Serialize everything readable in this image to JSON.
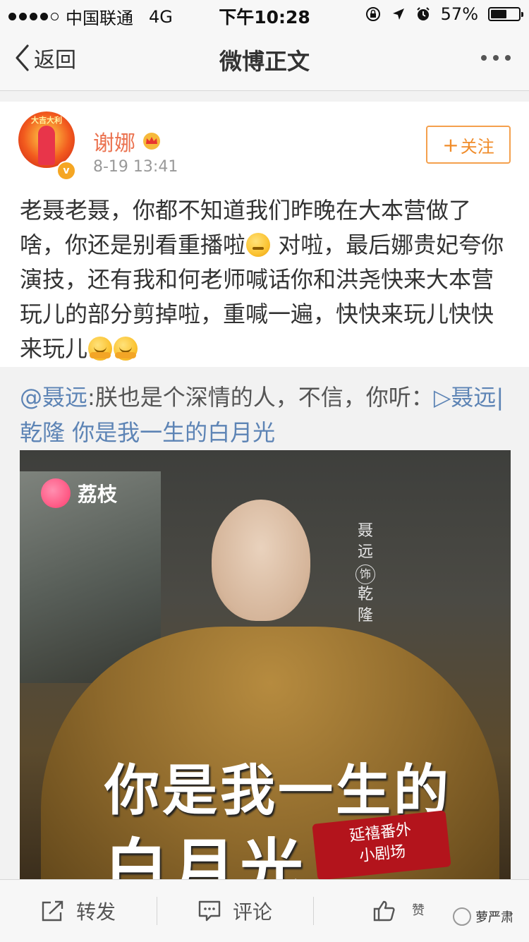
{
  "status_bar": {
    "carrier": "中国联通",
    "network": "4G",
    "time": "下午10:28",
    "battery": "57%",
    "battery_level": 0.57
  },
  "nav": {
    "back_label": "返回",
    "title": "微博正文"
  },
  "post": {
    "username": "谢娜",
    "timestamp": "8-19 13:41",
    "follow_label": "关注",
    "avatar_caption": "大吉大利",
    "text_a": "老聂老聂，你都不知道我们昨晚在大本营做了啥，你还是别看重播啦",
    "text_b": " 对啦，最后娜贵妃夸你演技，还有我和何老师喊话你和洪尧快来大本营玩儿的部分剪掉啦，重喊一遍，快快来玩儿快快来玩儿"
  },
  "repost": {
    "mention": "@聂远",
    "text": ":朕也是个深情的人，不信，你听：",
    "link": "▷聂远|乾隆 你是我一生的白月光",
    "image": {
      "brand": "荔枝",
      "vertical_caption": [
        "聂",
        "远",
        "饰",
        "乾",
        "隆"
      ],
      "title_line1": "你是我一生的",
      "title_line2": "白月光",
      "stamp_line1": "延禧番外",
      "stamp_line2": "小剧场"
    }
  },
  "toolbar": {
    "repost_label": "转发",
    "comment_label": "评论",
    "like_label": "赞"
  },
  "watermark": "萝严肃",
  "colors": {
    "username": "#eb7350",
    "follow": "#f08c2a",
    "link": "#5d84b5"
  }
}
